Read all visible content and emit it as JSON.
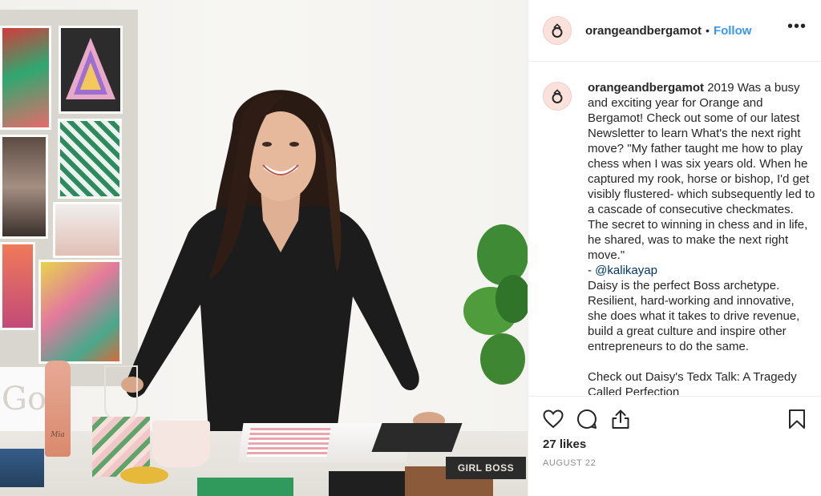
{
  "post": {
    "username": "orangeandbergamot",
    "follow_label": "Follow",
    "separator": "•",
    "more_label": "•••",
    "caption": {
      "username": "orangeandbergamot",
      "text_before_mention": " 2019 Was a busy and exciting year for Orange and Bergamot! Check out some of our latest Newsletter to learn What's the next right move? \"My father taught me how to play chess when I was six years old. When he captured my rook, horse or bishop, I'd get visibly flustered- which subsequently led to a cascade of consecutive checkmates. The secret to winning in chess and in life, he shared, was to make the next right move.\"\n- ",
      "mention": "@kalikayap",
      "text_after_mention": "\nDaisy is the perfect Boss archetype. Resilient, hard-working and innovative, she does what it takes to drive revenue, build a great culture and inspire other entrepreneurs to do the same.\n\nCheck out Daisy's Tedx Talk: A Tragedy Called Perfection"
    },
    "likes": "27 likes",
    "date": "AUGUST 22",
    "photo": {
      "bottle_label": "Mia",
      "box_label": "GIRL BOSS"
    },
    "icons": [
      "heart-icon",
      "comment-icon",
      "share-icon",
      "bookmark-icon",
      "ring-logo-icon"
    ],
    "colors": {
      "accent": "#3897f0",
      "mention": "#003569",
      "muted": "#8e8e8e"
    }
  }
}
